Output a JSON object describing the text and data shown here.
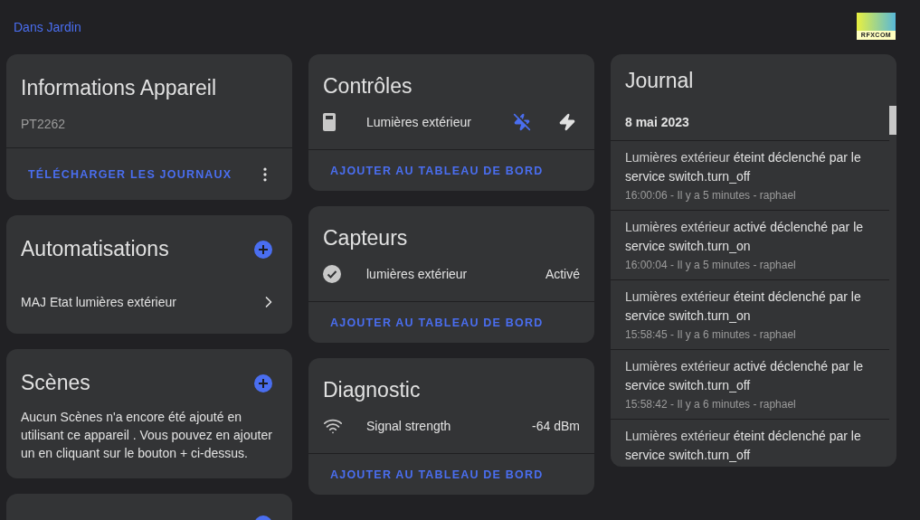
{
  "breadcrumb": "Dans Jardin",
  "logo": {
    "text": "RFXCOM"
  },
  "device_info": {
    "title": "Informations Appareil",
    "model": "PT2262",
    "action": "TÉLÉCHARGER LES JOURNAUX"
  },
  "automations": {
    "title": "Automatisations",
    "items": [
      {
        "label": "MAJ Etat lumières extérieur"
      }
    ]
  },
  "scenes": {
    "title": "Scènes",
    "empty_text": "Aucun Scènes n'a encore été ajouté en utilisant ce appareil . Vous pouvez en ajouter un en cliquant sur le bouton + ci-dessus."
  },
  "controls": {
    "title": "Contrôles",
    "rows": [
      {
        "kind": "remote",
        "name": "Lumières extérieur",
        "buttons": [
          {
            "kind": "off",
            "selected": true
          },
          {
            "kind": "on",
            "selected": false
          }
        ]
      }
    ],
    "action": "AJOUTER AU TABLEAU DE BORD"
  },
  "sensors": {
    "title": "Capteurs",
    "rows": [
      {
        "kind": "check",
        "name": "lumières extérieur",
        "value": "Activé"
      }
    ],
    "action": "AJOUTER AU TABLEAU DE BORD"
  },
  "diagnostic": {
    "title": "Diagnostic",
    "rows": [
      {
        "kind": "wifi",
        "name": "Signal strength",
        "value": "-64 dBm"
      }
    ],
    "action": "AJOUTER AU TABLEAU DE BORD"
  },
  "journal": {
    "title": "Journal",
    "date": "8 mai 2023",
    "entries": [
      {
        "entity": "Lumières extérieur",
        "message": "éteint déclenché par le service switch.turn_off",
        "meta": "16:00:06 - Il y a 5 minutes - raphael"
      },
      {
        "entity": "Lumières extérieur",
        "message": "activé déclenché par le service switch.turn_on",
        "meta": "16:00:04 - Il y a 5 minutes - raphael"
      },
      {
        "entity": "Lumières extérieur",
        "message": "éteint déclenché par le service switch.turn_on",
        "meta": "15:58:45 - Il y a 6 minutes - raphael"
      },
      {
        "entity": "Lumières extérieur",
        "message": "activé déclenché par le service switch.turn_off",
        "meta": "15:58:42 - Il y a 6 minutes - raphael"
      },
      {
        "entity": "Lumières extérieur",
        "message": "éteint déclenché par le service switch.turn_off"
      }
    ]
  }
}
